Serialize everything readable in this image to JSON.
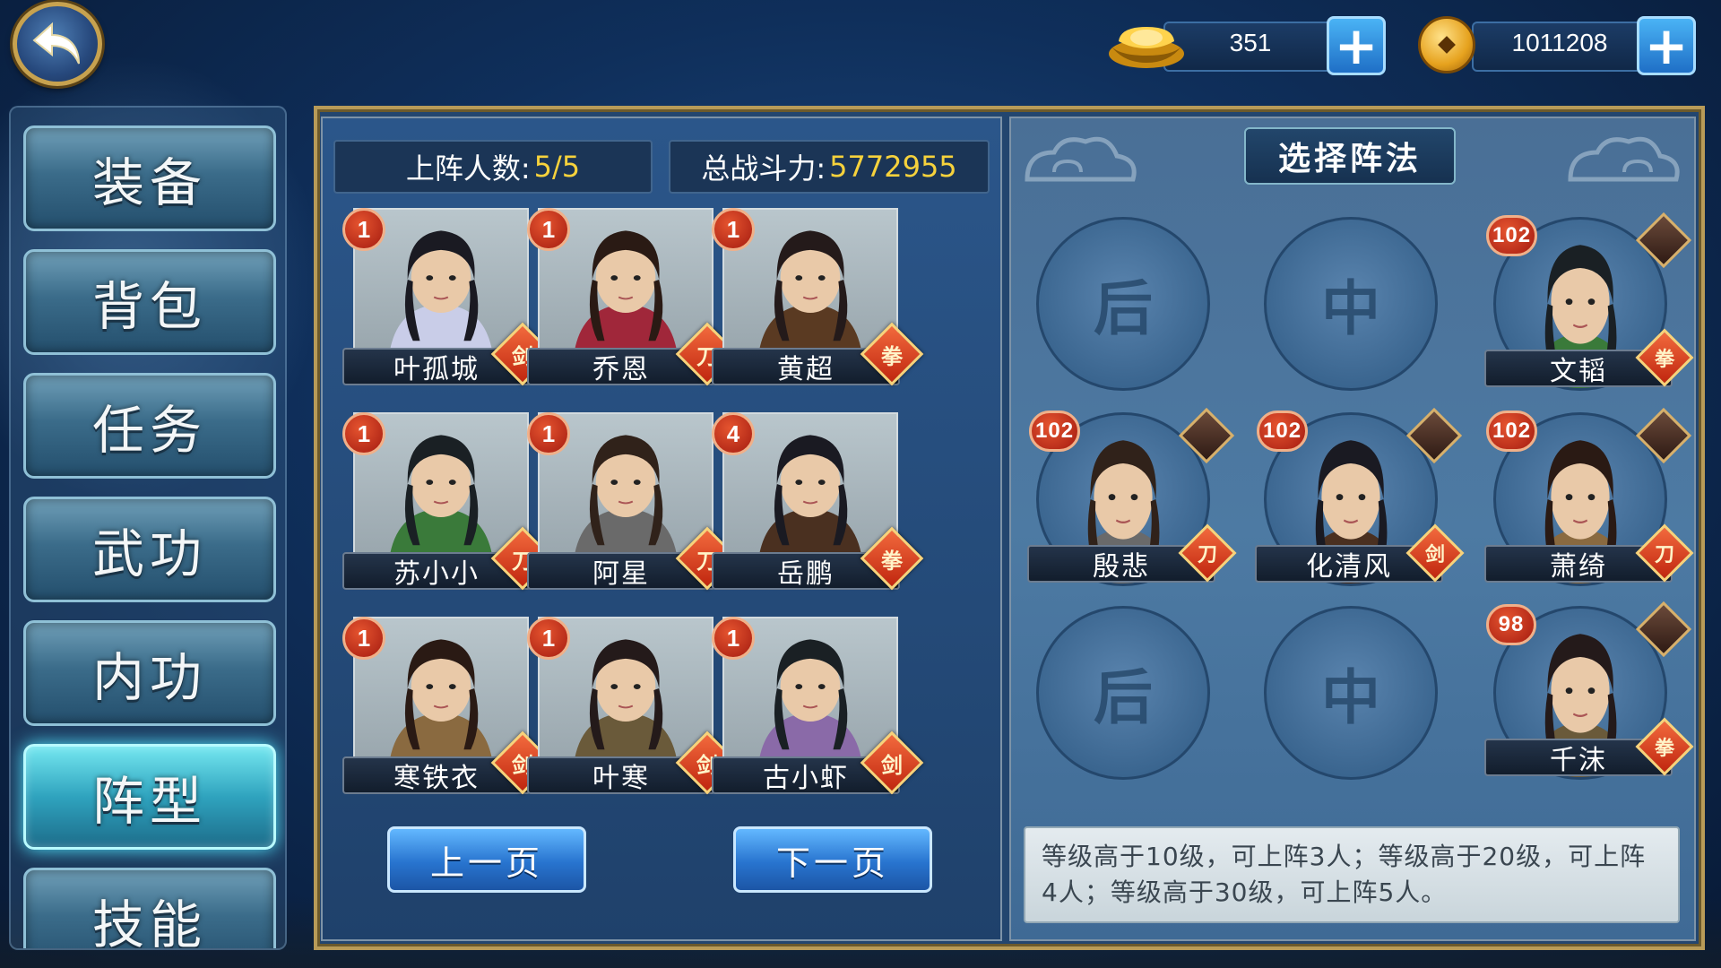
{
  "currency": {
    "ingot": "351",
    "coin": "1011208",
    "add_label": "+"
  },
  "menu": [
    {
      "label": "装备",
      "active": false
    },
    {
      "label": "背包",
      "active": false
    },
    {
      "label": "任务",
      "active": false
    },
    {
      "label": "武功",
      "active": false
    },
    {
      "label": "内功",
      "active": false
    },
    {
      "label": "阵型",
      "active": true
    },
    {
      "label": "技能",
      "active": false
    }
  ],
  "stats": {
    "slots_label": "上阵人数:",
    "slots_value": "5/5",
    "power_label": "总战斗力:",
    "power_value": "5772955"
  },
  "heroes": [
    {
      "name": "叶孤城",
      "level": "1",
      "type": "sword",
      "type_glyph": "剑"
    },
    {
      "name": "乔恩",
      "level": "1",
      "type": "blade",
      "type_glyph": "刀"
    },
    {
      "name": "黄超",
      "level": "1",
      "type": "fist",
      "type_glyph": "拳"
    },
    {
      "name": "苏小小",
      "level": "1",
      "type": "blade",
      "type_glyph": "刀"
    },
    {
      "name": "阿星",
      "level": "1",
      "type": "blade",
      "type_glyph": "刀"
    },
    {
      "name": "岳鹏",
      "level": "4",
      "type": "fist",
      "type_glyph": "拳"
    },
    {
      "name": "寒铁衣",
      "level": "1",
      "type": "sword",
      "type_glyph": "剑"
    },
    {
      "name": "叶寒",
      "level": "1",
      "type": "sword",
      "type_glyph": "剑"
    },
    {
      "name": "古小虾",
      "level": "1",
      "type": "sword",
      "type_glyph": "剑"
    }
  ],
  "pager": {
    "prev": "上一页",
    "next": "下一页"
  },
  "formation": {
    "title": "选择阵法",
    "slot_back": "后",
    "slot_mid": "中",
    "members": [
      {
        "name": "文韬",
        "level": "102",
        "type_glyph": "拳"
      },
      {
        "name": "殷悲",
        "level": "102",
        "type_glyph": "刀"
      },
      {
        "name": "化清风",
        "level": "102",
        "type_glyph": "剑"
      },
      {
        "name": "萧绮",
        "level": "102",
        "type_glyph": "刀"
      },
      {
        "name": "千沫",
        "level": "98",
        "type_glyph": "拳"
      }
    ],
    "hint": "等级高于10级，可上阵3人；等级高于20级，可上阵4人；等级高于30级，可上阵5人。"
  },
  "colors": {
    "highlight_number": "#f6d23c",
    "active_menu": "#53e7ff",
    "level_badge": "#c3301b"
  }
}
